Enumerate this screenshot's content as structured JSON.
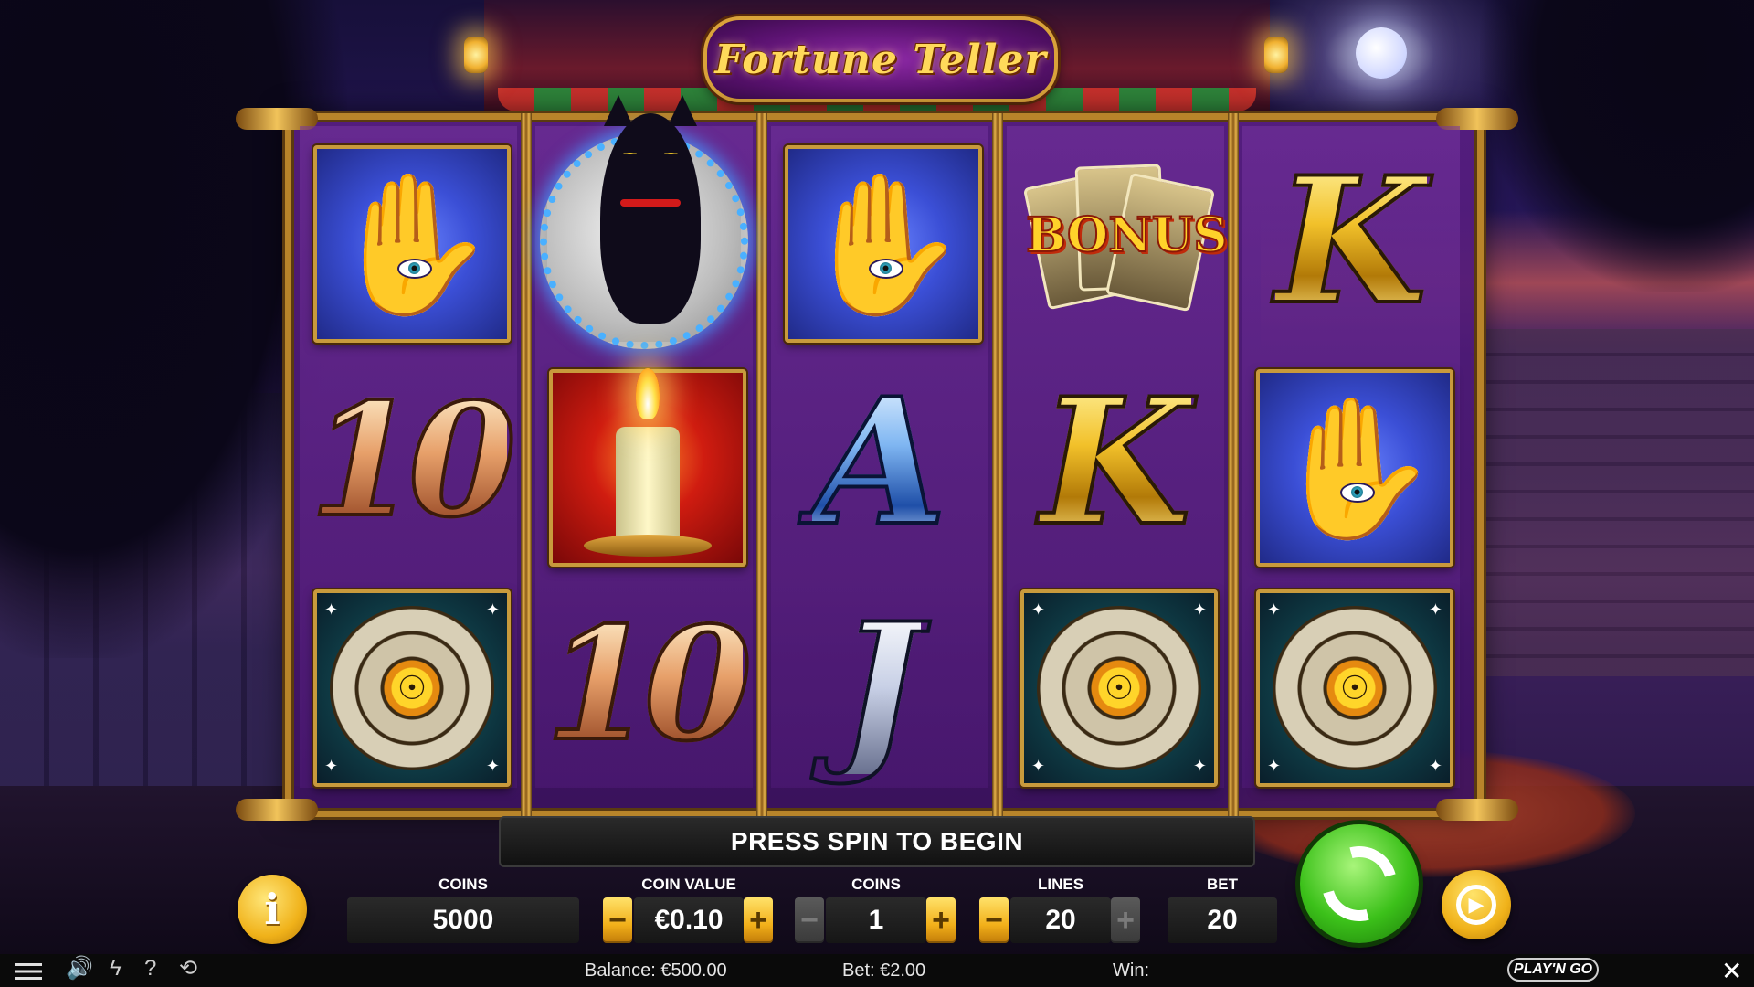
{
  "game": {
    "title": "Fortune Teller",
    "message": "PRESS SPIN TO BEGIN"
  },
  "reels": [
    [
      "palm-eye",
      "10",
      "zodiac-wheel"
    ],
    [
      "black-cat-moon",
      "candle",
      "10"
    ],
    [
      "palm-eye",
      "A",
      "J"
    ],
    [
      "bonus-tarot",
      "K",
      "zodiac-wheel"
    ],
    [
      "K",
      "palm-eye",
      "zodiac-wheel"
    ]
  ],
  "symbols": {
    "ten": "10",
    "ace": "A",
    "king": "K",
    "jack": "J",
    "bonus": "BONUS"
  },
  "controls": {
    "coins_label": "COINS",
    "coins_total": "5000",
    "coin_value_label": "COIN VALUE",
    "coin_value": "€0.10",
    "coins_per_line_label": "COINS",
    "coins_per_line": "1",
    "lines_label": "LINES",
    "lines": "20",
    "bet_label": "BET",
    "bet": "20",
    "minus": "−",
    "plus": "+",
    "info": "i"
  },
  "status_bar": {
    "balance": "Balance: €500.00",
    "bet": "Bet: €2.00",
    "win": "Win:",
    "brand": "PLAY'N GO"
  },
  "colors": {
    "frame_gold": "#b8842a",
    "spin_green": "#3cc11a",
    "button_gold": "#f2b01a",
    "reel_purple": "#581e82"
  }
}
